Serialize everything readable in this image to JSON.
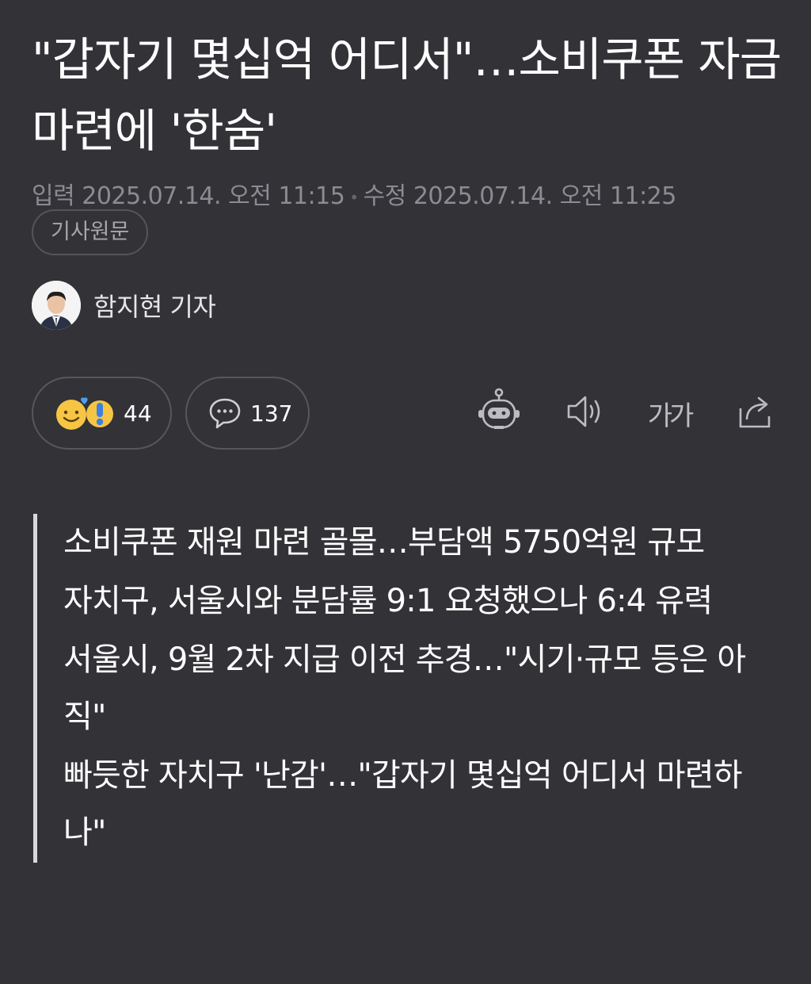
{
  "article": {
    "headline": "\"갑자기 몇십억 어디서\"…소비쿠폰 자금 마련에 '한숨'",
    "input_label": "입력",
    "input_date": "2025.07.14. 오전 11:15",
    "edit_label": "수정",
    "edit_date": "2025.07.14. 오전 11:25",
    "original_button": "기사원문",
    "author": "함지현 기자"
  },
  "actions": {
    "reaction_count": "44",
    "comment_count": "137",
    "font_size_icon_text": "가가"
  },
  "summary": [
    "소비쿠폰 재원 마련 골몰…부담액 5750억원 규모",
    "자치구, 서울시와 분담률 9:1 요청했으나 6:4 유력",
    "서울시, 9월 2차 지급 이전 추경…\"시기·규모 등은 아직\"",
    "빠듯한 자치구 '난감'…\"갑자기 몇십억 어디서 마련하나\""
  ],
  "icons": [
    "smile-heart-emoji-icon",
    "exclamation-emoji-icon",
    "comment-icon",
    "robot-icon",
    "speaker-icon",
    "font-size-icon",
    "share-icon"
  ],
  "colors": {
    "background": "#333237",
    "text": "#ffffff",
    "muted": "#8c8b91",
    "border": "#58575d"
  }
}
